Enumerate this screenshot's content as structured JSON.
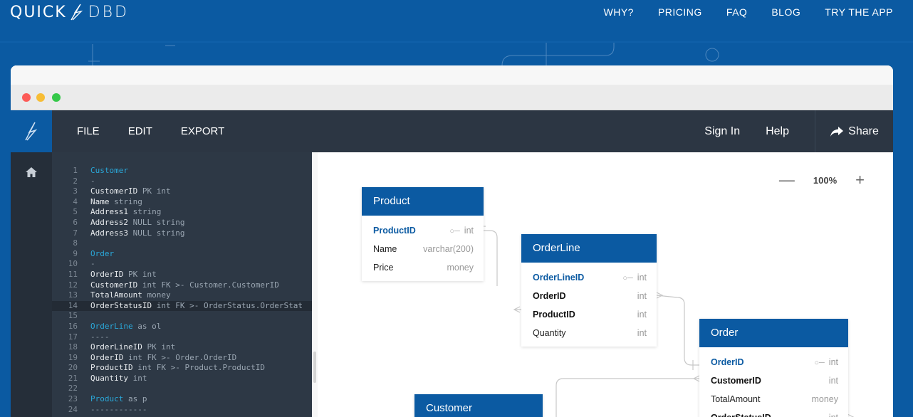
{
  "site": {
    "logo_left": "QUICK",
    "logo_right": "DBD",
    "nav": [
      "WHY?",
      "PRICING",
      "FAQ",
      "BLOG",
      "TRY THE APP"
    ]
  },
  "app": {
    "menu": {
      "file": "FILE",
      "edit": "EDIT",
      "export": "EXPORT"
    },
    "right": {
      "sign_in": "Sign In",
      "help": "Help",
      "share": "Share"
    },
    "zoom": {
      "minus": "—",
      "value": "100%",
      "plus": "+"
    }
  },
  "editor": {
    "lines": [
      {
        "n": "1",
        "parts": [
          [
            "tk-table",
            "Customer"
          ]
        ]
      },
      {
        "n": "2",
        "parts": [
          [
            "tk-dim",
            "-"
          ]
        ]
      },
      {
        "n": "3",
        "parts": [
          [
            "tk-field",
            "CustomerID"
          ],
          [
            "tk-kw",
            " PK int"
          ]
        ]
      },
      {
        "n": "4",
        "parts": [
          [
            "tk-field",
            "Name"
          ],
          [
            "tk-kw",
            " string"
          ]
        ]
      },
      {
        "n": "5",
        "parts": [
          [
            "tk-field",
            "Address1"
          ],
          [
            "tk-kw",
            " string"
          ]
        ]
      },
      {
        "n": "6",
        "parts": [
          [
            "tk-field",
            "Address2"
          ],
          [
            "tk-kw",
            " NULL string"
          ]
        ]
      },
      {
        "n": "7",
        "parts": [
          [
            "tk-field",
            "Address3"
          ],
          [
            "tk-kw",
            " NULL string"
          ]
        ]
      },
      {
        "n": "8",
        "parts": []
      },
      {
        "n": "9",
        "parts": [
          [
            "tk-table",
            "Order"
          ]
        ]
      },
      {
        "n": "10",
        "parts": [
          [
            "tk-dim",
            "-"
          ]
        ]
      },
      {
        "n": "11",
        "parts": [
          [
            "tk-field",
            "OrderID"
          ],
          [
            "tk-kw",
            " PK int"
          ]
        ]
      },
      {
        "n": "12",
        "parts": [
          [
            "tk-field",
            "CustomerID"
          ],
          [
            "tk-kw",
            " int FK >- Customer.CustomerID"
          ]
        ]
      },
      {
        "n": "13",
        "parts": [
          [
            "tk-field",
            "TotalAmount"
          ],
          [
            "tk-kw",
            " money"
          ]
        ]
      },
      {
        "n": "14",
        "parts": [
          [
            "tk-field",
            "OrderStatusID"
          ],
          [
            "tk-kw",
            " int FK >- OrderStatus.OrderStat"
          ]
        ],
        "active": true
      },
      {
        "n": "15",
        "parts": []
      },
      {
        "n": "16",
        "parts": [
          [
            "tk-table",
            "OrderLine"
          ],
          [
            "tk-kw",
            " as ol"
          ]
        ]
      },
      {
        "n": "17",
        "parts": [
          [
            "tk-dim",
            "----"
          ]
        ]
      },
      {
        "n": "18",
        "parts": [
          [
            "tk-field",
            "OrderLineID"
          ],
          [
            "tk-kw",
            " PK int"
          ]
        ]
      },
      {
        "n": "19",
        "parts": [
          [
            "tk-field",
            "OrderID"
          ],
          [
            "tk-kw",
            " int FK >- Order.OrderID"
          ]
        ]
      },
      {
        "n": "20",
        "parts": [
          [
            "tk-field",
            "ProductID"
          ],
          [
            "tk-kw",
            " int FK >- Product.ProductID"
          ]
        ]
      },
      {
        "n": "21",
        "parts": [
          [
            "tk-field",
            "Quantity"
          ],
          [
            "tk-kw",
            " int"
          ]
        ]
      },
      {
        "n": "22",
        "parts": []
      },
      {
        "n": "23",
        "parts": [
          [
            "tk-table",
            "Product"
          ],
          [
            "tk-kw",
            " as p"
          ]
        ]
      },
      {
        "n": "24",
        "parts": [
          [
            "tk-dim",
            "------------"
          ]
        ]
      }
    ]
  },
  "entities": [
    {
      "title": "Product",
      "rows": [
        {
          "name": "ProductID",
          "type": "int",
          "kind": "pk"
        },
        {
          "name": "Name",
          "type": "varchar(200)",
          "kind": ""
        },
        {
          "name": "Price",
          "type": "money",
          "kind": ""
        }
      ]
    },
    {
      "title": "OrderLine",
      "rows": [
        {
          "name": "OrderLineID",
          "type": "int",
          "kind": "pk"
        },
        {
          "name": "OrderID",
          "type": "int",
          "kind": "fk"
        },
        {
          "name": "ProductID",
          "type": "int",
          "kind": "fk"
        },
        {
          "name": "Quantity",
          "type": "int",
          "kind": ""
        }
      ]
    },
    {
      "title": "Order",
      "rows": [
        {
          "name": "OrderID",
          "type": "int",
          "kind": "pk"
        },
        {
          "name": "CustomerID",
          "type": "int",
          "kind": "fk"
        },
        {
          "name": "TotalAmount",
          "type": "money",
          "kind": ""
        },
        {
          "name": "OrderStatusID",
          "type": "int",
          "kind": "fk"
        }
      ]
    },
    {
      "title": "Customer",
      "rows": []
    }
  ]
}
